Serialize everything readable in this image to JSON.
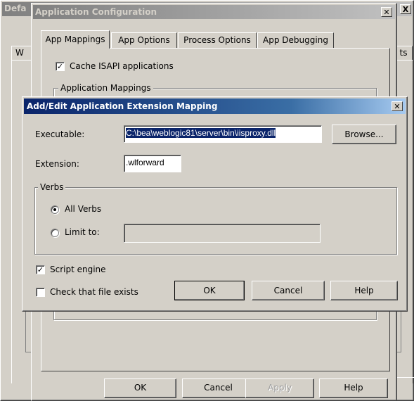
{
  "background_window": {
    "title": "Defa",
    "close_glyph": "X",
    "left_tab_fragment": "W",
    "right_tab_fragment": "ts"
  },
  "app_config": {
    "title": "Application Configuration",
    "close_glyph": "✕",
    "tabs": [
      "App Mappings",
      "App Options",
      "Process Options",
      "App Debugging"
    ],
    "cache_isapi_label": "Cache ISAPI applications",
    "cache_isapi_checked": true,
    "mappings_group_label": "Application Mappings",
    "buttons": {
      "ok": "OK",
      "cancel": "Cancel",
      "apply": "Apply",
      "help": "Help"
    }
  },
  "mapping_dialog": {
    "title": "Add/Edit Application Extension Mapping",
    "close_glyph": "✕",
    "executable_label": "Executable:",
    "executable_value": "C:\\bea\\weblogic81\\server\\bin\\iisproxy.dll",
    "browse_label": "Browse...",
    "extension_label": "Extension:",
    "extension_value": ".wlforward",
    "verbs_group_label": "Verbs",
    "all_verbs_label": "All Verbs",
    "limit_to_label": "Limit to:",
    "limit_to_value": "",
    "selected_verb_option": "All Verbs",
    "script_engine_label": "Script engine",
    "script_engine_checked": true,
    "check_file_exists_label": "Check that file exists",
    "check_file_exists_checked": false,
    "buttons": {
      "ok": "OK",
      "cancel": "Cancel",
      "help": "Help"
    }
  },
  "colors": {
    "face": "#d4d0c8",
    "active_title": "#0a246a",
    "inactive_title": "#808080",
    "selection": "#0a246a"
  }
}
